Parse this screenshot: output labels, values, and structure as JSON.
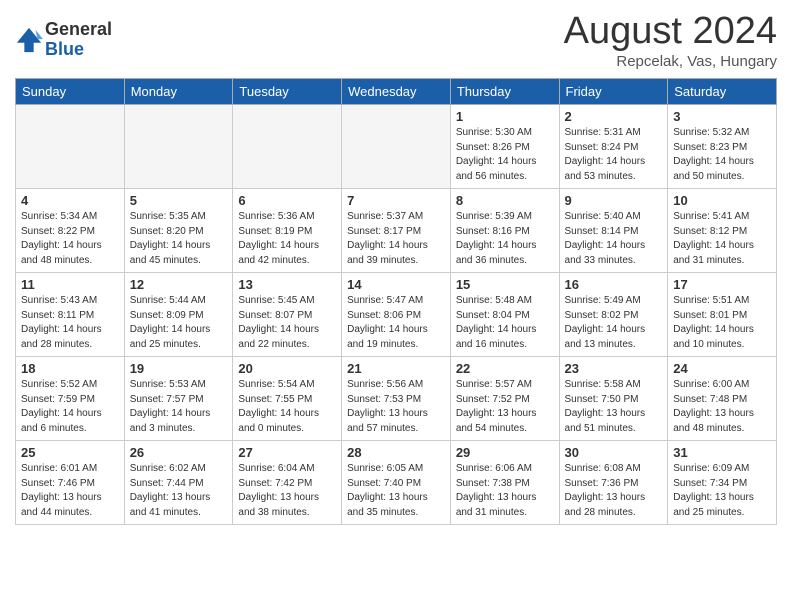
{
  "logo": {
    "general": "General",
    "blue": "Blue"
  },
  "title": "August 2024",
  "location": "Repcelak, Vas, Hungary",
  "headers": [
    "Sunday",
    "Monday",
    "Tuesday",
    "Wednesday",
    "Thursday",
    "Friday",
    "Saturday"
  ],
  "weeks": [
    [
      {
        "day": "",
        "empty": true
      },
      {
        "day": "",
        "empty": true
      },
      {
        "day": "",
        "empty": true
      },
      {
        "day": "",
        "empty": true
      },
      {
        "day": "1",
        "info": "Sunrise: 5:30 AM\nSunset: 8:26 PM\nDaylight: 14 hours\nand 56 minutes."
      },
      {
        "day": "2",
        "info": "Sunrise: 5:31 AM\nSunset: 8:24 PM\nDaylight: 14 hours\nand 53 minutes."
      },
      {
        "day": "3",
        "info": "Sunrise: 5:32 AM\nSunset: 8:23 PM\nDaylight: 14 hours\nand 50 minutes."
      }
    ],
    [
      {
        "day": "4",
        "info": "Sunrise: 5:34 AM\nSunset: 8:22 PM\nDaylight: 14 hours\nand 48 minutes."
      },
      {
        "day": "5",
        "info": "Sunrise: 5:35 AM\nSunset: 8:20 PM\nDaylight: 14 hours\nand 45 minutes."
      },
      {
        "day": "6",
        "info": "Sunrise: 5:36 AM\nSunset: 8:19 PM\nDaylight: 14 hours\nand 42 minutes."
      },
      {
        "day": "7",
        "info": "Sunrise: 5:37 AM\nSunset: 8:17 PM\nDaylight: 14 hours\nand 39 minutes."
      },
      {
        "day": "8",
        "info": "Sunrise: 5:39 AM\nSunset: 8:16 PM\nDaylight: 14 hours\nand 36 minutes."
      },
      {
        "day": "9",
        "info": "Sunrise: 5:40 AM\nSunset: 8:14 PM\nDaylight: 14 hours\nand 33 minutes."
      },
      {
        "day": "10",
        "info": "Sunrise: 5:41 AM\nSunset: 8:12 PM\nDaylight: 14 hours\nand 31 minutes."
      }
    ],
    [
      {
        "day": "11",
        "info": "Sunrise: 5:43 AM\nSunset: 8:11 PM\nDaylight: 14 hours\nand 28 minutes."
      },
      {
        "day": "12",
        "info": "Sunrise: 5:44 AM\nSunset: 8:09 PM\nDaylight: 14 hours\nand 25 minutes."
      },
      {
        "day": "13",
        "info": "Sunrise: 5:45 AM\nSunset: 8:07 PM\nDaylight: 14 hours\nand 22 minutes."
      },
      {
        "day": "14",
        "info": "Sunrise: 5:47 AM\nSunset: 8:06 PM\nDaylight: 14 hours\nand 19 minutes."
      },
      {
        "day": "15",
        "info": "Sunrise: 5:48 AM\nSunset: 8:04 PM\nDaylight: 14 hours\nand 16 minutes."
      },
      {
        "day": "16",
        "info": "Sunrise: 5:49 AM\nSunset: 8:02 PM\nDaylight: 14 hours\nand 13 minutes."
      },
      {
        "day": "17",
        "info": "Sunrise: 5:51 AM\nSunset: 8:01 PM\nDaylight: 14 hours\nand 10 minutes."
      }
    ],
    [
      {
        "day": "18",
        "info": "Sunrise: 5:52 AM\nSunset: 7:59 PM\nDaylight: 14 hours\nand 6 minutes."
      },
      {
        "day": "19",
        "info": "Sunrise: 5:53 AM\nSunset: 7:57 PM\nDaylight: 14 hours\nand 3 minutes."
      },
      {
        "day": "20",
        "info": "Sunrise: 5:54 AM\nSunset: 7:55 PM\nDaylight: 14 hours\nand 0 minutes."
      },
      {
        "day": "21",
        "info": "Sunrise: 5:56 AM\nSunset: 7:53 PM\nDaylight: 13 hours\nand 57 minutes."
      },
      {
        "day": "22",
        "info": "Sunrise: 5:57 AM\nSunset: 7:52 PM\nDaylight: 13 hours\nand 54 minutes."
      },
      {
        "day": "23",
        "info": "Sunrise: 5:58 AM\nSunset: 7:50 PM\nDaylight: 13 hours\nand 51 minutes."
      },
      {
        "day": "24",
        "info": "Sunrise: 6:00 AM\nSunset: 7:48 PM\nDaylight: 13 hours\nand 48 minutes."
      }
    ],
    [
      {
        "day": "25",
        "info": "Sunrise: 6:01 AM\nSunset: 7:46 PM\nDaylight: 13 hours\nand 44 minutes."
      },
      {
        "day": "26",
        "info": "Sunrise: 6:02 AM\nSunset: 7:44 PM\nDaylight: 13 hours\nand 41 minutes."
      },
      {
        "day": "27",
        "info": "Sunrise: 6:04 AM\nSunset: 7:42 PM\nDaylight: 13 hours\nand 38 minutes."
      },
      {
        "day": "28",
        "info": "Sunrise: 6:05 AM\nSunset: 7:40 PM\nDaylight: 13 hours\nand 35 minutes."
      },
      {
        "day": "29",
        "info": "Sunrise: 6:06 AM\nSunset: 7:38 PM\nDaylight: 13 hours\nand 31 minutes."
      },
      {
        "day": "30",
        "info": "Sunrise: 6:08 AM\nSunset: 7:36 PM\nDaylight: 13 hours\nand 28 minutes."
      },
      {
        "day": "31",
        "info": "Sunrise: 6:09 AM\nSunset: 7:34 PM\nDaylight: 13 hours\nand 25 minutes."
      }
    ]
  ]
}
